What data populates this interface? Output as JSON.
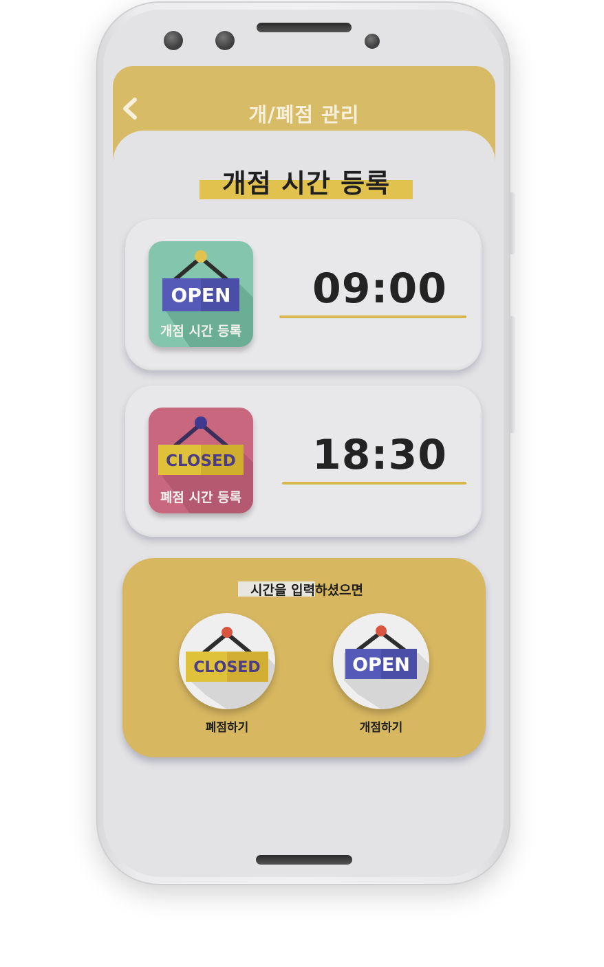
{
  "header": {
    "title": "개/폐점 관리",
    "back_icon": "chevron-left-icon"
  },
  "section": {
    "title": "개점 시간 등록"
  },
  "open_card": {
    "sign_text": "OPEN",
    "label": "개점 시간 등록",
    "time": "09:00",
    "color": "#84c5ad"
  },
  "close_card": {
    "sign_text": "CLOSED",
    "label": "폐점 시간 등록",
    "time": "18:30",
    "color": "#c9677f"
  },
  "action_panel": {
    "prompt": "시간을 입력하셨으면",
    "close_button": {
      "sign_text": "CLOSED",
      "label": "폐점하기"
    },
    "open_button": {
      "sign_text": "OPEN",
      "label": "개점하기"
    }
  },
  "colors": {
    "accent": "#d7bb66",
    "open_sign": "#5559b8",
    "closed_sign": "#e0c13a"
  }
}
